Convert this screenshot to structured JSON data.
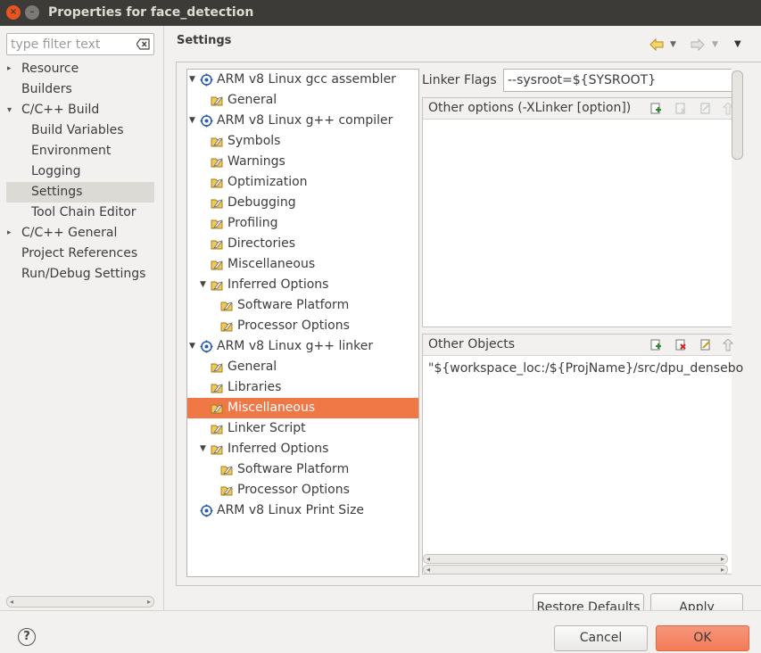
{
  "window": {
    "title": "Properties for face_detection",
    "close_glyph": "×",
    "min_glyph": "–"
  },
  "filter": {
    "placeholder": "type filter text"
  },
  "nav": {
    "items": [
      {
        "label": "Resource",
        "level": 0,
        "arrow": "closed"
      },
      {
        "label": "Builders",
        "level": 0,
        "arrow": "none"
      },
      {
        "label": "C/C++ Build",
        "level": 0,
        "arrow": "open"
      },
      {
        "label": "Build Variables",
        "level": 1,
        "arrow": "none"
      },
      {
        "label": "Environment",
        "level": 1,
        "arrow": "none"
      },
      {
        "label": "Logging",
        "level": 1,
        "arrow": "none"
      },
      {
        "label": "Settings",
        "level": 1,
        "arrow": "none",
        "selected": true
      },
      {
        "label": "Tool Chain Editor",
        "level": 1,
        "arrow": "none"
      },
      {
        "label": "C/C++ General",
        "level": 0,
        "arrow": "closed"
      },
      {
        "label": "Project References",
        "level": 0,
        "arrow": "none"
      },
      {
        "label": "Run/Debug Settings",
        "level": 0,
        "arrow": "none"
      }
    ]
  },
  "settings": {
    "title": "Settings",
    "back_icon": "back-arrow-icon",
    "forward_icon": "forward-arrow-icon"
  },
  "tree": {
    "rows": [
      {
        "label": "ARM v8 Linux gcc assembler",
        "level": 0,
        "expander": "open",
        "icon": "tool-icon"
      },
      {
        "label": "General",
        "level": 1,
        "expander": "none",
        "icon": "folder-icon"
      },
      {
        "label": "ARM v8 Linux g++ compiler",
        "level": 0,
        "expander": "open",
        "icon": "tool-icon"
      },
      {
        "label": "Symbols",
        "level": 1,
        "expander": "none",
        "icon": "folder-icon"
      },
      {
        "label": "Warnings",
        "level": 1,
        "expander": "none",
        "icon": "folder-icon"
      },
      {
        "label": "Optimization",
        "level": 1,
        "expander": "none",
        "icon": "folder-icon"
      },
      {
        "label": "Debugging",
        "level": 1,
        "expander": "none",
        "icon": "folder-icon"
      },
      {
        "label": "Profiling",
        "level": 1,
        "expander": "none",
        "icon": "folder-icon"
      },
      {
        "label": "Directories",
        "level": 1,
        "expander": "none",
        "icon": "folder-icon"
      },
      {
        "label": "Miscellaneous",
        "level": 1,
        "expander": "none",
        "icon": "folder-icon"
      },
      {
        "label": "Inferred Options",
        "level": 1,
        "expander": "open",
        "icon": "folder-icon"
      },
      {
        "label": "Software Platform",
        "level": 2,
        "expander": "none",
        "icon": "folder-icon"
      },
      {
        "label": "Processor Options",
        "level": 2,
        "expander": "none",
        "icon": "folder-icon"
      },
      {
        "label": "ARM v8 Linux g++ linker",
        "level": 0,
        "expander": "open",
        "icon": "tool-icon"
      },
      {
        "label": "General",
        "level": 1,
        "expander": "none",
        "icon": "folder-icon"
      },
      {
        "label": "Libraries",
        "level": 1,
        "expander": "none",
        "icon": "folder-icon"
      },
      {
        "label": "Miscellaneous",
        "level": 1,
        "expander": "none",
        "icon": "folder-icon",
        "selected": true
      },
      {
        "label": "Linker Script",
        "level": 1,
        "expander": "none",
        "icon": "folder-icon"
      },
      {
        "label": "Inferred Options",
        "level": 1,
        "expander": "open",
        "icon": "folder-icon"
      },
      {
        "label": "Software Platform",
        "level": 2,
        "expander": "none",
        "icon": "folder-icon"
      },
      {
        "label": "Processor Options",
        "level": 2,
        "expander": "none",
        "icon": "folder-icon"
      },
      {
        "label": "ARM v8 Linux Print Size",
        "level": 0,
        "expander": "none",
        "icon": "tool-icon"
      }
    ]
  },
  "linker": {
    "flags_label": "Linker Flags",
    "flags_value": "--sysroot=${SYSROOT}"
  },
  "other_options": {
    "title": "Other options (-XLinker [option])"
  },
  "other_objects": {
    "title": "Other Objects",
    "items": [
      "\"${workspace_loc:/${ProjName}/src/dpu_densebo"
    ]
  },
  "buttons": {
    "restore_defaults": "Restore Defaults",
    "apply": "Apply",
    "cancel": "Cancel",
    "ok": "OK",
    "help_glyph": "?"
  },
  "colors": {
    "selection": "#f07746",
    "ok_button": "#f47c58",
    "titlebar": "#3c3b37"
  }
}
